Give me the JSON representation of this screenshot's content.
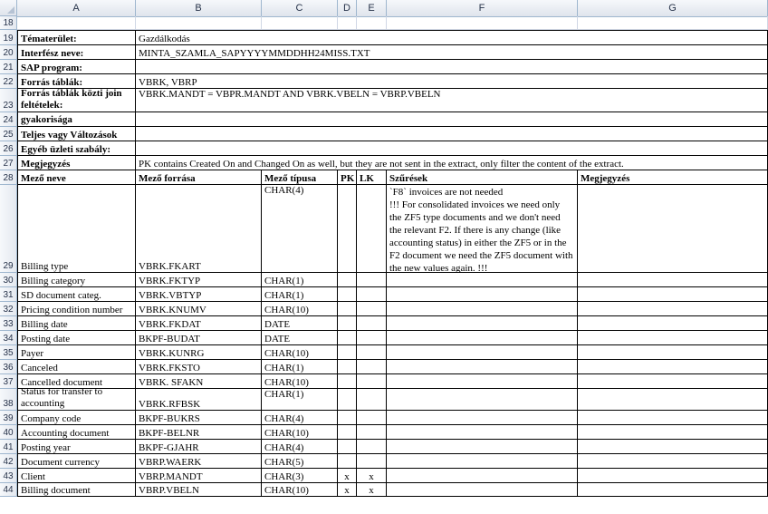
{
  "columns": [
    "A",
    "B",
    "C",
    "D",
    "E",
    "F",
    "G"
  ],
  "rows": [
    {
      "num": "18",
      "a": "",
      "b": "",
      "c": "",
      "d": "",
      "e": "",
      "f": "",
      "g": ""
    },
    {
      "num": "19",
      "a": "Tématerület:",
      "b": "Gazdálkodás"
    },
    {
      "num": "20",
      "a": "Interfész neve:",
      "b": "MINTA_SZAMLA_SAPYYYYMMDDHH24MISS.TXT"
    },
    {
      "num": "21",
      "a": "SAP program:",
      "b": ""
    },
    {
      "num": "22",
      "a": "Forrás táblák:",
      "b": "VBRK, VBRP"
    },
    {
      "num": "23",
      "a": "Forrás táblák közti join feltételek:",
      "b": "VBRK.MANDT = VBPR.MANDT AND VBRK.VBELN = VBRP.VBELN"
    },
    {
      "num": "24",
      "a": "Interfész előállítás gyakorisága",
      "b": ""
    },
    {
      "num": "25",
      "a": "Teljes vagy Változások",
      "b": ""
    },
    {
      "num": "26",
      "a": "Egyéb üzleti szabály:",
      "b": ""
    },
    {
      "num": "27",
      "a": "Megjegyzés",
      "b": "PK contains Created On and Changed On as well, but they are not sent in the extract, only filter the content of the extract."
    },
    {
      "num": "28",
      "a": "Mező neve",
      "b": "Mező forrása",
      "c": "Mező típusa",
      "d": "PK",
      "e": "LK",
      "f": "Szűrések",
      "g": "Megjegyzés"
    },
    {
      "num": "29",
      "a": "Billing type",
      "b": "VBRK.FKART",
      "c": "CHAR(4)",
      "d": "",
      "e": "",
      "f": "`F8` invoices are not needed\n!!! For consolidated invoices we need only the ZF5 type documents and we don't need the relevant F2. If there is any change (like accounting status) in either the ZF5 or in the F2 document we need the ZF5 document with the new values again. !!!",
      "g": ""
    },
    {
      "num": "30",
      "a": "Billing category",
      "b": "VBRK.FKTYP",
      "c": "CHAR(1)"
    },
    {
      "num": "31",
      "a": "SD document categ.",
      "b": "VBRK.VBTYP",
      "c": "CHAR(1)"
    },
    {
      "num": "32",
      "a": "Pricing condition number",
      "b": "VBRK.KNUMV",
      "c": "CHAR(10)"
    },
    {
      "num": "33",
      "a": "Billing date",
      "b": "VBRK.FKDAT",
      "c": "DATE"
    },
    {
      "num": "34",
      "a": "Posting date",
      "b": "BKPF-BUDAT",
      "c": "DATE"
    },
    {
      "num": "35",
      "a": "Payer",
      "b": "VBRK.KUNRG",
      "c": "CHAR(10)"
    },
    {
      "num": "36",
      "a": "Canceled",
      "b": "VBRK.FKSTO",
      "c": "CHAR(1)"
    },
    {
      "num": "37",
      "a": "Cancelled document",
      "b": "VBRK. SFAKN",
      "c": "CHAR(10)"
    },
    {
      "num": "38",
      "a": "Status for transfer to accounting",
      "b": "VBRK.RFBSK",
      "c": "CHAR(1)"
    },
    {
      "num": "39",
      "a": "Company code",
      "b": "BKPF-BUKRS",
      "c": "CHAR(4)"
    },
    {
      "num": "40",
      "a": "Accounting document",
      "b": "BKPF-BELNR",
      "c": "CHAR(10)"
    },
    {
      "num": "41",
      "a": "Posting year",
      "b": "BKPF-GJAHR",
      "c": "CHAR(4)"
    },
    {
      "num": "42",
      "a": "Document currency",
      "b": "VBRP.WAERK",
      "c": "CHAR(5)"
    },
    {
      "num": "43",
      "a": "Client",
      "b": "VBRP.MANDT",
      "c": "CHAR(3)",
      "d": "x",
      "e": "x"
    },
    {
      "num": "44",
      "a": "Billing document",
      "b": "VBRP.VBELN",
      "c": "CHAR(10)",
      "d": "x",
      "e": "x"
    }
  ]
}
